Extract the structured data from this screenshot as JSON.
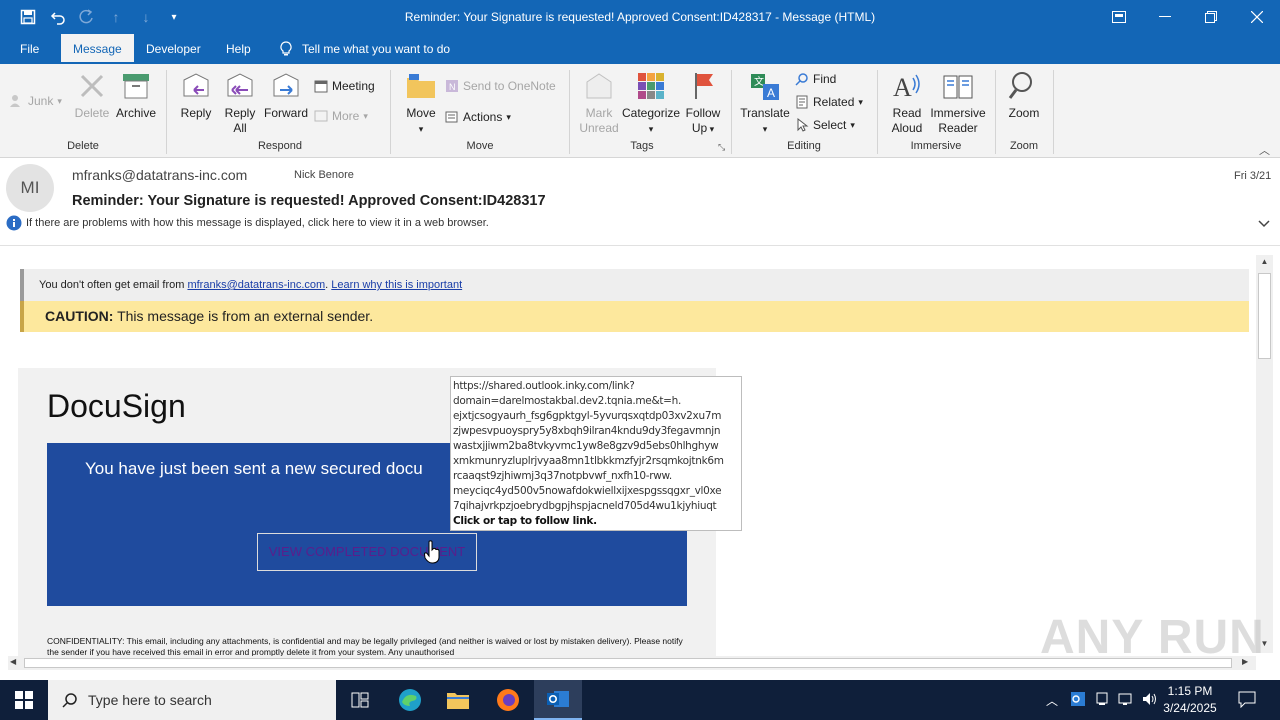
{
  "window": {
    "title": "Reminder: Your Signature is requested! Approved Consent:ID428317  -  Message (HTML)"
  },
  "tabs": [
    "File",
    "Message",
    "Developer",
    "Help"
  ],
  "tell_me": "Tell me what you want to do",
  "ribbon": {
    "junk": "Junk",
    "delete": "Delete",
    "archive": "Archive",
    "group_delete": "Delete",
    "reply": "Reply",
    "reply_all_1": "Reply",
    "reply_all_2": "All",
    "forward": "Forward",
    "meeting": "Meeting",
    "more": "More",
    "group_respond": "Respond",
    "move": "Move",
    "send_onenote": "Send to OneNote",
    "actions": "Actions",
    "group_move": "Move",
    "mark_unread_1": "Mark",
    "mark_unread_2": "Unread",
    "categorize": "Categorize",
    "follow_up_1": "Follow",
    "follow_up_2": "Up",
    "group_tags": "Tags",
    "translate": "Translate",
    "find": "Find",
    "related": "Related",
    "select": "Select",
    "group_editing": "Editing",
    "read_aloud_1": "Read",
    "read_aloud_2": "Aloud",
    "immersive_1": "Immersive",
    "immersive_2": "Reader",
    "group_immersive": "Immersive",
    "zoom": "Zoom",
    "group_zoom": "Zoom"
  },
  "message": {
    "avatar_initials": "MI",
    "from": "mfranks@datatrans-inc.com",
    "to": "Nick Benore",
    "date": "Fri 3/21",
    "subject": "Reminder: Your Signature is requested! Approved Consent:ID428317",
    "info_bar": "If there are problems with how this message is displayed, click here to view it in a web browser."
  },
  "body": {
    "notice_prefix": "You don't often get email from ",
    "notice_email": "mfranks@datatrans-inc.com",
    "notice_sep": ". ",
    "notice_link": "Learn why this is important",
    "caution_label": "CAUTION:",
    "caution_text": " This message is from an external sender.",
    "logo": "DocuSign",
    "headline": "You have just been sent a new secured docu",
    "button": "VIEW COMPLETED DOCUMENT",
    "confidentiality": "CONFIDENTIALITY: This email, including any attachments, is confidential and may be legally privileged (and neither is waived or lost by mistaken delivery). Please notify the sender if you have received this email in error and promptly delete it from your system. Any unauthorised"
  },
  "tooltip": {
    "url": "https://shared.outlook.inky.com/link?\ndomain=darelmostakbal.dev2.tqnia.me&t=h.\nejxtjcsogyaurh_fsg6gpktgyl-5yvurqsxqtdp03xv2xu7m\nzjwpesvpuoyspry5y8xbqh9ilran4kndu9dy3fegavmnjn\nwastxjjiwm2ba8tvkyvmc1yw8e8gzv9d5ebs0hlhghyw\nxmkmunryzluplrjvyaa8mn1tlbkkmzfyjr2rsqmkojtnk6m\nrcaaqst9zjhiwmj3q37notpbvwf_nxfh10-rww.\nmeyciqc4yd500v5nowafdokwiellxijxespgssqgxr_vl0xe\n7qihajvrkpzjoebrydbgpjhspjacneld705d4wu1kjyhiuqt",
    "follow": "Click or tap to follow link."
  },
  "taskbar": {
    "search_placeholder": "Type here to search",
    "time": "1:15 PM",
    "date": "3/24/2025"
  },
  "watermark": "ANY RUN",
  "colors": {
    "accent": "#1366b6",
    "docusign_blue": "#1f4b9e",
    "caution_bg": "#fde89d"
  }
}
